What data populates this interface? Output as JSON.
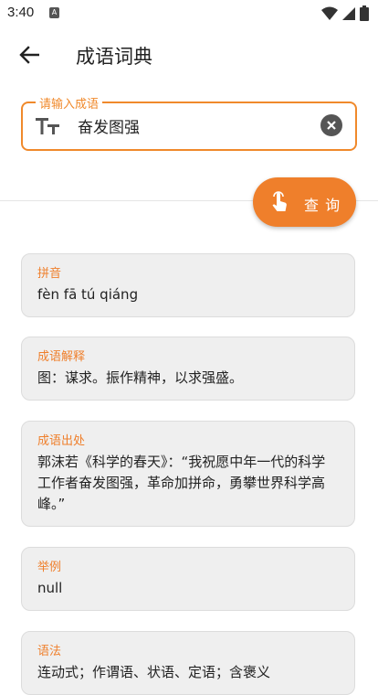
{
  "status": {
    "time": "3:40",
    "notif_letter": "A"
  },
  "app_bar": {
    "title": "成语词典"
  },
  "search": {
    "label": "请输入成语",
    "value": "奋发图强"
  },
  "query_button": {
    "label": "查 询"
  },
  "cards": [
    {
      "title": "拼音",
      "text": "fèn fā tú qiáng"
    },
    {
      "title": "成语解释",
      "text": "图：谋求。振作精神，以求强盛。"
    },
    {
      "title": "成语出处",
      "text": "郭沫若《科学的春天》：“我祝愿中年一代的科学工作者奋发图强，革命加拼命，勇攀世界科学高峰。”"
    },
    {
      "title": "举例",
      "text": "null"
    },
    {
      "title": "语法",
      "text": "连动式；作谓语、状语、定语；含褒义"
    }
  ],
  "colors": {
    "accent": "#ef7f2b",
    "card_bg": "#efefef"
  }
}
